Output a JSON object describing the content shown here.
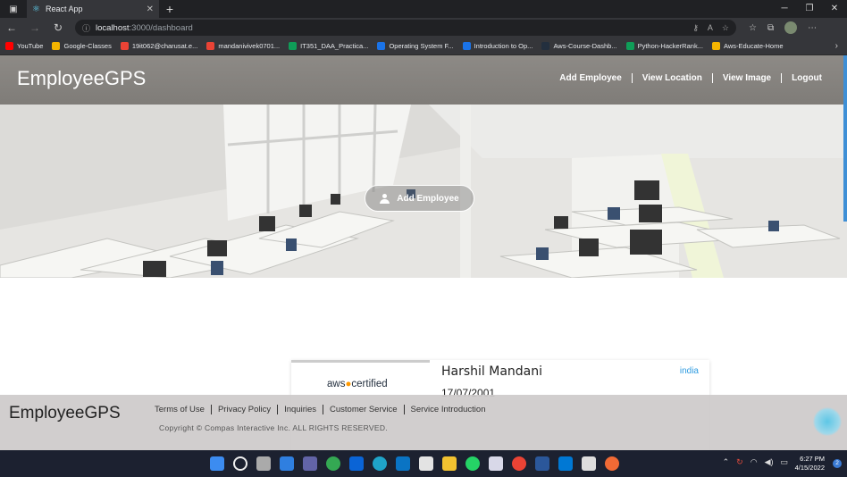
{
  "browser": {
    "tab_title": "React App",
    "url_host": "localhost",
    "url_path": ":3000/dashboard",
    "bookmarks": [
      {
        "label": "YouTube",
        "color": "#ff0000"
      },
      {
        "label": "Google-Classes",
        "color": "#f4b400"
      },
      {
        "label": "19it062@charusat.e...",
        "color": "#ea4335"
      },
      {
        "label": "mandanivivek0701...",
        "color": "#ea4335"
      },
      {
        "label": "IT351_DAA_Practica...",
        "color": "#0f9d58"
      },
      {
        "label": "Operating System F...",
        "color": "#1a73e8"
      },
      {
        "label": "Introduction to Op...",
        "color": "#1a73e8"
      },
      {
        "label": "Aws-Course-Dashb...",
        "color": "#232f3e"
      },
      {
        "label": "Python-HackerRank...",
        "color": "#0f9d58"
      },
      {
        "label": "Aws-Educate-Home",
        "color": "#f4b400"
      }
    ]
  },
  "header": {
    "brand": "EmployeeGPS",
    "nav": [
      "Add Employee",
      "View Location",
      "View Image",
      "Logout"
    ]
  },
  "hero": {
    "button_label": "Add Employee"
  },
  "card": {
    "logo_text_1": "aws",
    "logo_text_2": "certified",
    "name": "Harshil Mandani",
    "dob": "17/07/2001",
    "country": "india"
  },
  "footer": {
    "brand": "EmployeeGPS",
    "links": [
      "Terms of Use",
      "Privacy Policy",
      "Inquiries",
      "Customer Service",
      "Service Introduction"
    ],
    "copyright": "Copyright © Compas Interactive Inc. ALL RIGHTS RESERVED."
  },
  "taskbar": {
    "time": "6:27 PM",
    "date": "4/15/2022",
    "notifications": "2"
  }
}
